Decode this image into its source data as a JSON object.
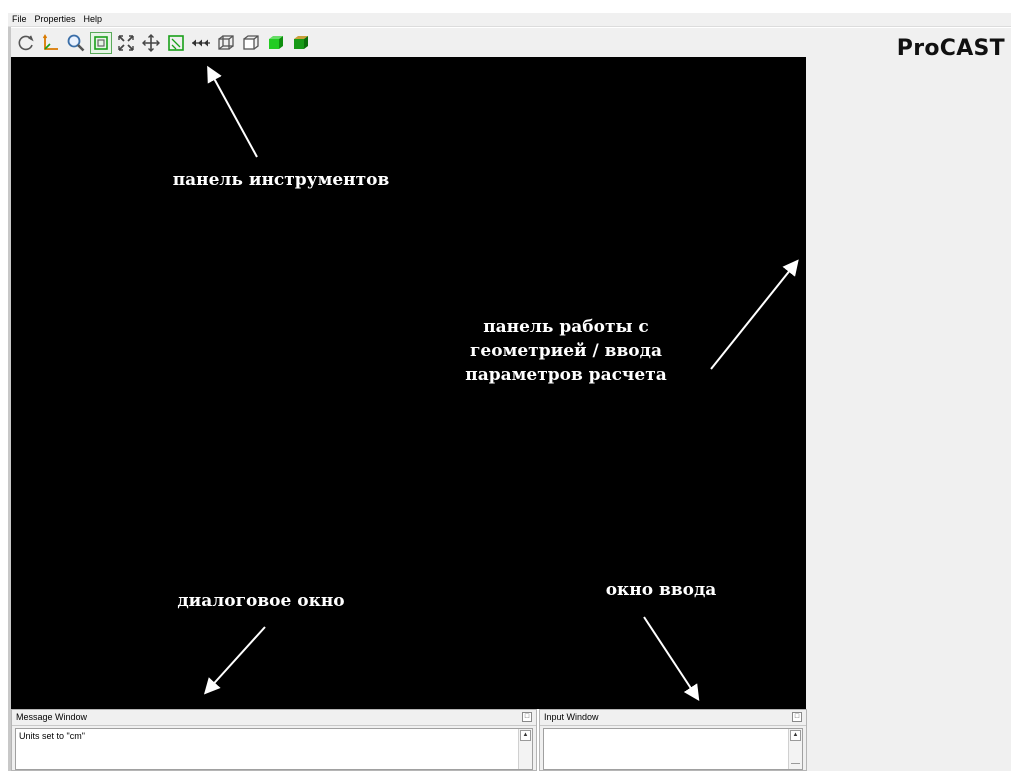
{
  "menu": {
    "items": [
      "File",
      "Properties",
      "Help"
    ]
  },
  "toolbar": {
    "buttons": [
      {
        "icon": "rotate-icon"
      },
      {
        "icon": "axis-icon"
      },
      {
        "icon": "zoom-icon"
      },
      {
        "icon": "frame-icon",
        "active": true
      },
      {
        "icon": "fit-view-icon"
      },
      {
        "icon": "pan-icon"
      },
      {
        "icon": "select-box-icon"
      },
      {
        "icon": "arrows-left-icon"
      },
      {
        "icon": "wireframe-cube-icon"
      },
      {
        "icon": "outline-cube-icon"
      },
      {
        "icon": "solid-cube-icon"
      },
      {
        "icon": "shaded-cube-icon"
      }
    ]
  },
  "logo": {
    "text": "ProCAST"
  },
  "annotations": {
    "toolbar_label": "панель инструментов",
    "geometry_label": "панель работы с\nгеометрией / ввода\nпараметров расчета",
    "dialog_label": "диалоговое окно",
    "input_label": "окно ввода"
  },
  "message_window": {
    "title": "Message Window",
    "content": "Units set to \"cm\""
  },
  "input_window": {
    "title": "Input Window",
    "content": ""
  },
  "colors": {
    "viewport": "#000000",
    "chrome": "#f0f0f0",
    "accent_green": "#22aa22",
    "annotation_text": "#ffffff"
  }
}
